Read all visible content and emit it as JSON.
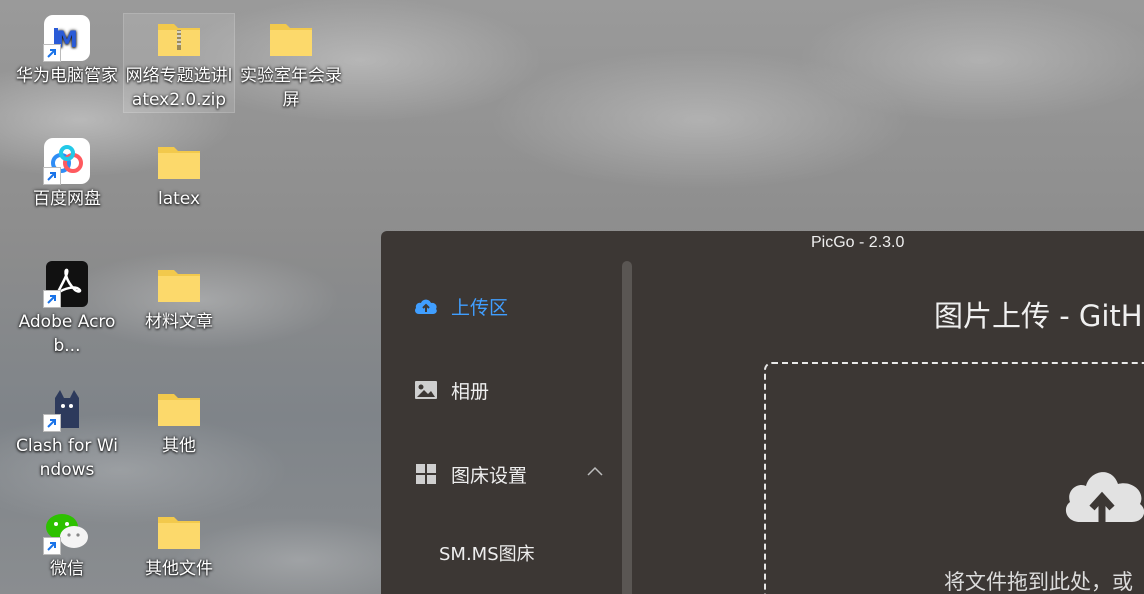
{
  "desktop": {
    "icons": [
      {
        "label": "华为电脑管家",
        "icon": "huawei-pc-manager-icon"
      },
      {
        "label": "网络专题选讲latex2.0.zip",
        "icon": "zip-folder-icon"
      },
      {
        "label": "实验室年会录屏",
        "icon": "folder-icon"
      },
      {
        "label": "百度网盘",
        "icon": "baidu-netdisk-icon"
      },
      {
        "label": "latex",
        "icon": "folder-icon"
      },
      {
        "label": "Adobe Acrob...",
        "icon": "adobe-acrobat-icon"
      },
      {
        "label": "材料文章",
        "icon": "folder-icon"
      },
      {
        "label": "Clash for Windows",
        "icon": "clash-cat-icon"
      },
      {
        "label": "其他",
        "icon": "folder-icon"
      },
      {
        "label": "微信",
        "icon": "wechat-icon"
      },
      {
        "label": "其他文件",
        "icon": "folder-icon"
      }
    ]
  },
  "picgo": {
    "window_title": "PicGo - 2.3.0",
    "sidebar": {
      "items": [
        {
          "label": "上传区",
          "icon": "cloud-upload-icon",
          "active": true
        },
        {
          "label": "相册",
          "icon": "image-icon"
        },
        {
          "label": "图床设置",
          "icon": "grid-icon"
        },
        {
          "label": "SM.MS图床"
        }
      ]
    },
    "main": {
      "title": "图片上传 - GitHu",
      "drop_text": "将文件拖到此处，或"
    },
    "colors": {
      "accent": "#409eff",
      "window_bg": "#3c3734"
    }
  }
}
